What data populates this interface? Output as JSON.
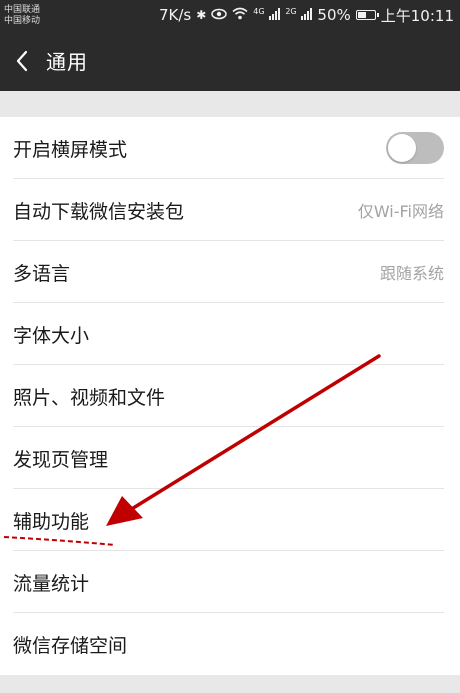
{
  "status_bar": {
    "carrier_1": "中国联通",
    "carrier_2": "中国移动",
    "speed": "7K/s",
    "net_1": "4G",
    "net_2": "2G",
    "battery": "50%",
    "battery_level": 0.5,
    "time": "上午10:11"
  },
  "nav": {
    "title": "通用"
  },
  "settings": {
    "landscape_mode": {
      "label": "开启横屏模式",
      "enabled": false
    },
    "auto_download": {
      "label": "自动下载微信安装包",
      "value": "仅Wi-Fi网络"
    },
    "language": {
      "label": "多语言",
      "value": "跟随系统"
    },
    "font_size": {
      "label": "字体大小"
    },
    "media": {
      "label": "照片、视频和文件"
    },
    "discover": {
      "label": "发现页管理"
    },
    "accessibility": {
      "label": "辅助功能"
    },
    "traffic": {
      "label": "流量统计"
    },
    "storage": {
      "label": "微信存储空间"
    }
  },
  "colors": {
    "header_bg": "#2b2b2b",
    "page_bg": "#e8e8e8",
    "annotation": "#c00000"
  }
}
